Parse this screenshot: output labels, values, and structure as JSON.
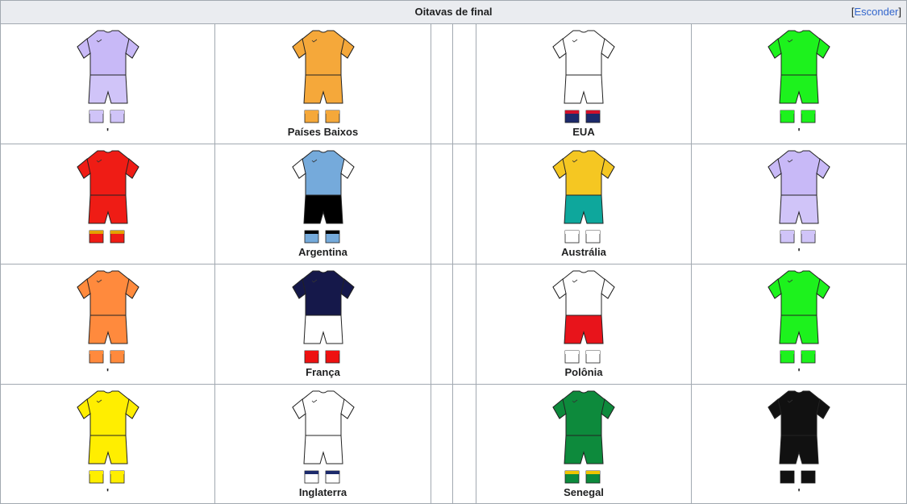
{
  "header": {
    "title": "Oitavas de final",
    "toggle_open": "[",
    "toggle_label": "Esconder",
    "toggle_close": "]"
  },
  "rows": [
    {
      "home": {
        "label": "'",
        "shirt": "#c8b9f7",
        "sleeve": "#c8b9f7",
        "shorts": "#d0c4f8",
        "socks": "#d0c4f8",
        "sockTop": "#d0c4f8"
      },
      "away": {
        "label": "Países Baixos",
        "shirt": "#f5a83a",
        "sleeve": "#f5a83a",
        "shorts": "#f5a83a",
        "socks": "#f5a83a",
        "sockTop": "#f5a83a"
      },
      "homeB": {
        "label": "EUA",
        "shirt": "#ffffff",
        "sleeve": "#ffffff",
        "shorts": "#ffffff",
        "socks": "#1c2a6b",
        "sockTop": "#d0102a"
      },
      "awayB": {
        "label": "'",
        "shirt": "#1df21d",
        "sleeve": "#1df21d",
        "shorts": "#1df21d",
        "socks": "#1df21d",
        "sockTop": "#1df21d"
      }
    },
    {
      "home": {
        "label": "",
        "shirt": "#ef1c15",
        "sleeve": "#ef1c15",
        "shorts": "#ef1c15",
        "socks": "#ef1c15",
        "sockTop": "#e2a200"
      },
      "away": {
        "label": "Argentina",
        "shirt": "#75aadb",
        "sleeve": "#ffffff",
        "shorts": "#000000",
        "socks": "#75aadb",
        "sockTop": "#000000"
      },
      "homeB": {
        "label": "Austrália",
        "shirt": "#f5c722",
        "sleeve": "#f5c722",
        "shorts": "#0ea79c",
        "socks": "#ffffff",
        "sockTop": "#ffffff"
      },
      "awayB": {
        "label": "'",
        "shirt": "#c8b9f7",
        "sleeve": "#c8b9f7",
        "shorts": "#d0c4f8",
        "socks": "#d0c4f8",
        "sockTop": "#d0c4f8"
      }
    },
    {
      "home": {
        "label": "'",
        "shirt": "#ff8a3d",
        "sleeve": "#ff8a3d",
        "shorts": "#ff8a3d",
        "socks": "#ff8a3d",
        "sockTop": "#ff8a3d"
      },
      "away": {
        "label": "França",
        "shirt": "#15184a",
        "sleeve": "#15184a",
        "shorts": "#ffffff",
        "socks": "#ee1111",
        "sockTop": "#ee1111"
      },
      "homeB": {
        "label": "Polônia",
        "shirt": "#ffffff",
        "sleeve": "#ffffff",
        "shorts": "#e8141b",
        "socks": "#ffffff",
        "sockTop": "#ffffff"
      },
      "awayB": {
        "label": "'",
        "shirt": "#1df21d",
        "sleeve": "#1df21d",
        "shorts": "#1df21d",
        "socks": "#1df21d",
        "sockTop": "#1df21d"
      }
    },
    {
      "home": {
        "label": "'",
        "shirt": "#ffee00",
        "sleeve": "#ffee00",
        "shorts": "#ffee00",
        "socks": "#ffee00",
        "sockTop": "#ffee00"
      },
      "away": {
        "label": "Inglaterra",
        "shirt": "#ffffff",
        "sleeve": "#ffffff",
        "shorts": "#ffffff",
        "socks": "#ffffff",
        "sockTop": "#1c2a6b"
      },
      "homeB": {
        "label": "Senegal",
        "shirt": "#0d8a3c",
        "sleeve": "#0d8a3c",
        "shorts": "#0d8a3c",
        "socks": "#0d8a3c",
        "sockTop": "#f0c400"
      },
      "awayB": {
        "label": "'",
        "shirt": "#111111",
        "sleeve": "#111111",
        "shorts": "#111111",
        "socks": "#111111",
        "sockTop": "#111111"
      }
    }
  ],
  "accent": "#3366cc",
  "border": "#a2a9b1",
  "header_bg": "#eaecf0"
}
